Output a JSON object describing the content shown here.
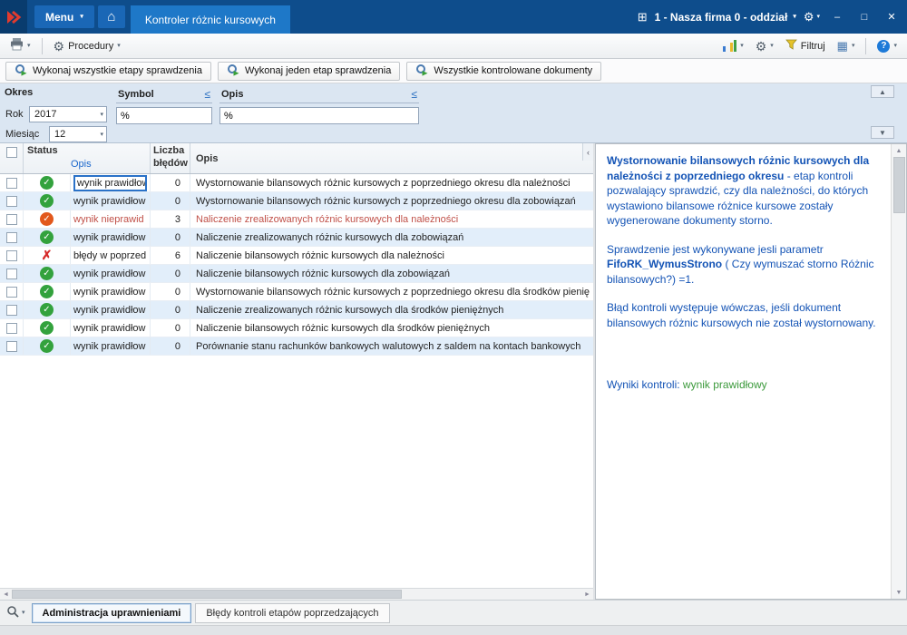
{
  "topbar": {
    "menu_label": "Menu",
    "active_tab": "Kontroler różnic kursowych",
    "company": "1 - Nasza firma 0 - oddział"
  },
  "toolbar": {
    "procedury_label": "Procedury",
    "filtruj_label": "Filtruj",
    "help_label": "?"
  },
  "actions": {
    "a1": "Wykonaj wszystkie etapy sprawdzenia",
    "a2": "Wykonaj jeden etap sprawdzenia",
    "a3": "Wszystkie kontrolowane dokumenty"
  },
  "filters": {
    "okres_label": "Okres",
    "rok_label": "Rok",
    "rok_value": "2017",
    "miesiac_label": "Miesiąc",
    "miesiac_value": "12",
    "symbol_label": "Symbol",
    "symbol_value": "%",
    "opis_label": "Opis",
    "opis_value": "%"
  },
  "table": {
    "headers": {
      "status": "Status",
      "status_opis": "Opis",
      "liczba_line1": "Liczba",
      "liczba_line2": "błędów",
      "opis": "Opis"
    },
    "rows": [
      {
        "status": "ok",
        "result": "wynik prawidłow",
        "errors": "0",
        "desc": "Wystornowanie bilansowych różnic kursowych z poprzedniego okresu dla należności"
      },
      {
        "status": "ok",
        "result": "wynik prawidłow",
        "errors": "0",
        "desc": "Wystornowanie bilansowych różnic kursowych z poprzedniego okresu dla zobowiązań"
      },
      {
        "status": "warn",
        "result": "wynik nieprawid",
        "errors": "3",
        "desc": "Naliczenie zrealizowanych różnic kursowych dla należności",
        "tone": "red"
      },
      {
        "status": "ok",
        "result": "wynik prawidłow",
        "errors": "0",
        "desc": "Naliczenie zrealizowanych różnic kursowych dla zobowiązań"
      },
      {
        "status": "error",
        "result": "błędy w poprzed",
        "errors": "6",
        "desc": "Naliczenie bilansowych różnic kursowych dla należności"
      },
      {
        "status": "ok",
        "result": "wynik prawidłow",
        "errors": "0",
        "desc": "Naliczenie bilansowych różnic kursowych dla zobowiązań"
      },
      {
        "status": "ok",
        "result": "wynik prawidłow",
        "errors": "0",
        "desc": "Wystornowanie bilansowych różnic kursowych z poprzedniego okresu dla środków pienię"
      },
      {
        "status": "ok",
        "result": "wynik prawidłow",
        "errors": "0",
        "desc": "Naliczenie zrealizowanych różnic kursowych dla środków pieniężnych"
      },
      {
        "status": "ok",
        "result": "wynik prawidłow",
        "errors": "0",
        "desc": "Naliczenie bilansowych różnic kursowych dla środków pieniężnych"
      },
      {
        "status": "ok",
        "result": "wynik prawidłow",
        "errors": "0",
        "desc": "Porównanie stanu rachunków bankowych walutowych z saldem na kontach bankowych"
      }
    ]
  },
  "detail": {
    "title": "Wystornowanie bilansowych różnic kursowych dla należności  z poprzedniego okresu",
    "p1_rest": " - etap kontroli pozwalający sprawdzić, czy dla należności, do których wystawiono  bilansowe różnice kursowe  zostały wygenerowane dokumenty storno.",
    "p2_pre": "Sprawdzenie jest wykonywane jesli parametr ",
    "p2_bold": "FifoRK_WymusStrono",
    "p2_post": " ( Czy wymuszać storno Różnic bilansowych?) =1.",
    "p3": "Błąd kontroli występuje wówczas, jeśli dokument bilansowych różnic kursowych nie został wystornowany.",
    "result_label": "Wyniki kontroli: ",
    "result_value": "wynik prawidłowy"
  },
  "bottom": {
    "tab1": "Administracja uprawnieniami",
    "tab2": "Błędy kontroli etapów poprzedzających"
  },
  "icons": {
    "caret_down": "▾",
    "home": "⌂",
    "apps_grid": "⊞",
    "gear": "⚙",
    "minimize": "–",
    "maximize": "□",
    "close": "✕",
    "lte": "≤",
    "chevron_up": "▲",
    "chevron_down": "▼",
    "chevron_left": "‹",
    "scroll_left": "◄",
    "scroll_right": "►",
    "grid_view": "▦"
  },
  "colors": {
    "navy": "#0e4d8c",
    "accent_blue": "#1e78c8",
    "status_ok": "#33a23d",
    "status_warn": "#e2581c",
    "status_error": "#d62b2b",
    "detail_text": "#1353b5",
    "result_green": "#3c9a3c",
    "error_row_text": "#c05048"
  }
}
